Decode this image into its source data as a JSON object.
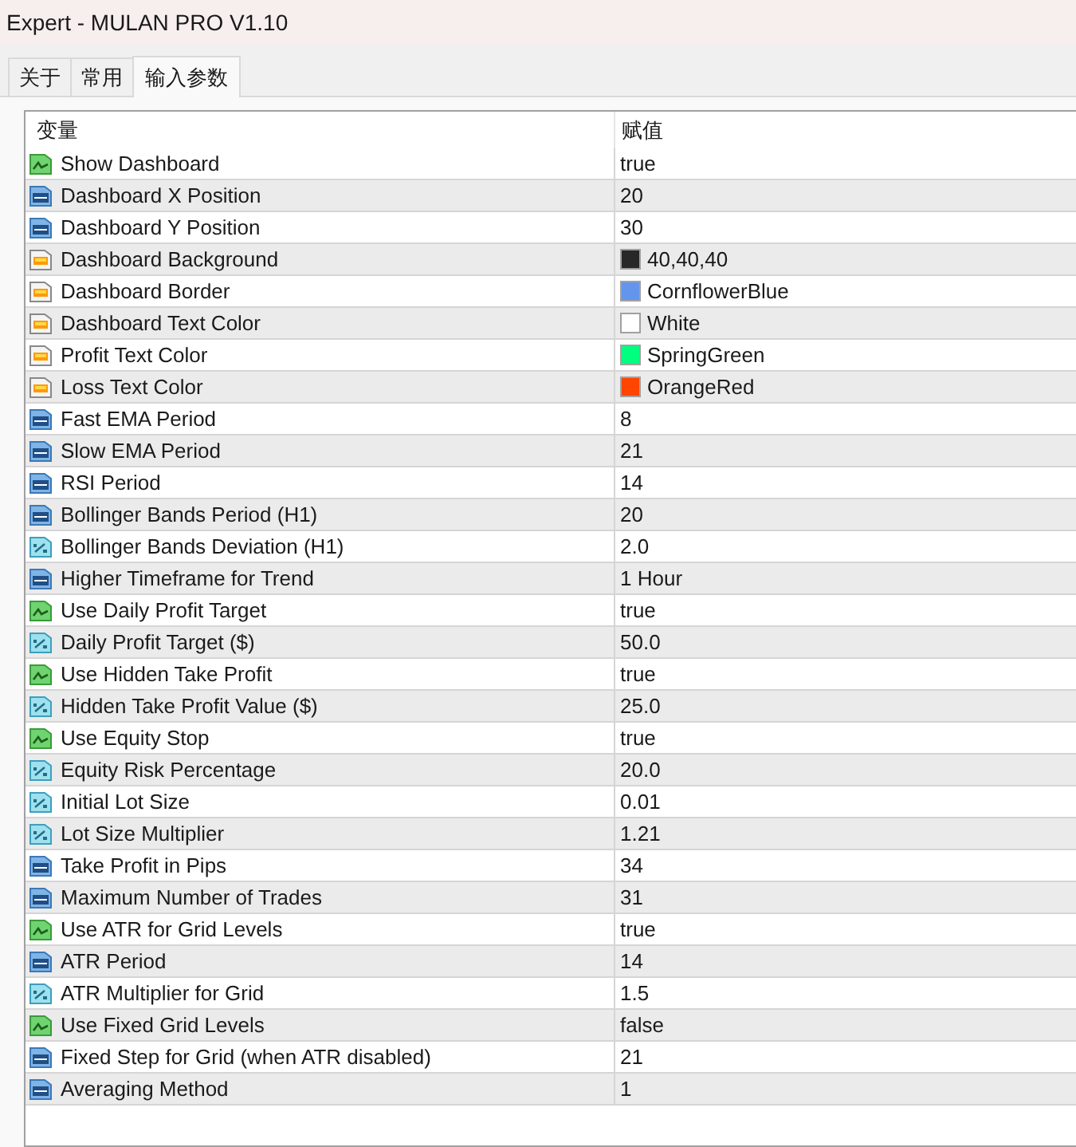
{
  "window": {
    "title": "Expert - MULAN PRO V1.10"
  },
  "tabs": [
    {
      "label": "关于",
      "selected": false
    },
    {
      "label": "常用",
      "selected": false
    },
    {
      "label": "输入参数",
      "selected": true
    }
  ],
  "table": {
    "columns": [
      "变量",
      "赋值"
    ],
    "rows": [
      {
        "kind": "bool",
        "name": "Show Dashboard",
        "value": "true"
      },
      {
        "kind": "int",
        "name": "Dashboard X Position",
        "value": "20"
      },
      {
        "kind": "int",
        "name": "Dashboard Y Position",
        "value": "30"
      },
      {
        "kind": "color",
        "name": "Dashboard Background",
        "value": "40,40,40",
        "color": "#282828"
      },
      {
        "kind": "color",
        "name": "Dashboard Border",
        "value": "CornflowerBlue",
        "color": "#6495ed"
      },
      {
        "kind": "color",
        "name": "Dashboard Text Color",
        "value": "White",
        "color": "#ffffff"
      },
      {
        "kind": "color",
        "name": "Profit Text Color",
        "value": "SpringGreen",
        "color": "#00ff7f"
      },
      {
        "kind": "color",
        "name": "Loss Text Color",
        "value": "OrangeRed",
        "color": "#ff4500"
      },
      {
        "kind": "int",
        "name": "Fast EMA Period",
        "value": "8"
      },
      {
        "kind": "int",
        "name": "Slow EMA Period",
        "value": "21"
      },
      {
        "kind": "int",
        "name": "RSI Period",
        "value": "14"
      },
      {
        "kind": "int",
        "name": "Bollinger Bands Period (H1)",
        "value": "20"
      },
      {
        "kind": "double",
        "name": "Bollinger Bands Deviation (H1)",
        "value": "2.0"
      },
      {
        "kind": "int",
        "name": "Higher Timeframe for Trend",
        "value": "1 Hour"
      },
      {
        "kind": "bool",
        "name": "Use Daily Profit Target",
        "value": "true"
      },
      {
        "kind": "double",
        "name": "Daily Profit Target ($)",
        "value": "50.0"
      },
      {
        "kind": "bool",
        "name": "Use Hidden Take Profit",
        "value": "true"
      },
      {
        "kind": "double",
        "name": "Hidden Take Profit Value ($)",
        "value": "25.0"
      },
      {
        "kind": "bool",
        "name": "Use Equity Stop",
        "value": "true"
      },
      {
        "kind": "double",
        "name": "Equity Risk Percentage",
        "value": "20.0"
      },
      {
        "kind": "double",
        "name": "Initial Lot Size",
        "value": "0.01"
      },
      {
        "kind": "double",
        "name": "Lot Size Multiplier",
        "value": "1.21"
      },
      {
        "kind": "int",
        "name": "Take Profit in Pips",
        "value": "34"
      },
      {
        "kind": "int",
        "name": "Maximum Number of Trades",
        "value": "31"
      },
      {
        "kind": "bool",
        "name": "Use ATR for Grid Levels",
        "value": "true"
      },
      {
        "kind": "int",
        "name": "ATR Period",
        "value": "14"
      },
      {
        "kind": "double",
        "name": "ATR Multiplier for Grid",
        "value": "1.5"
      },
      {
        "kind": "bool",
        "name": "Use Fixed Grid Levels",
        "value": "false"
      },
      {
        "kind": "int",
        "name": "Fixed Step for Grid (when ATR disabled)",
        "value": "21"
      },
      {
        "kind": "int",
        "name": "Averaging Method",
        "value": "1"
      }
    ]
  }
}
